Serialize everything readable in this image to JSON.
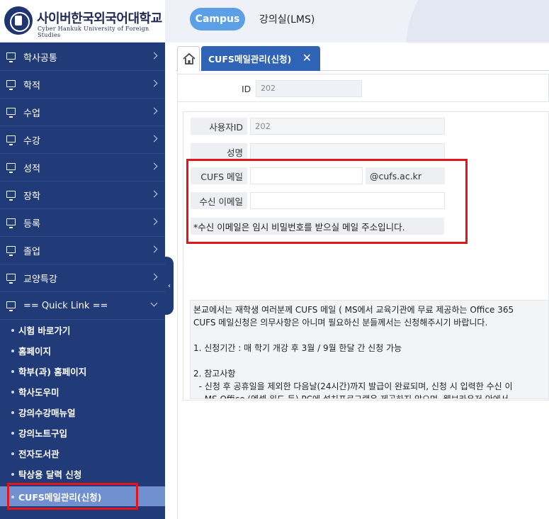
{
  "logo": {
    "name_kr": "사이버한국외국어대학교",
    "name_en": "Cyber Hankuk University of Foreign Studies"
  },
  "header": {
    "campus_label": "Campus",
    "lms_label": "강의실(LMS)"
  },
  "sidebar": {
    "items": [
      {
        "label": "학사공통"
      },
      {
        "label": "학적"
      },
      {
        "label": "수업"
      },
      {
        "label": "수강"
      },
      {
        "label": "성적"
      },
      {
        "label": "장학"
      },
      {
        "label": "등록"
      },
      {
        "label": "졸업"
      },
      {
        "label": "교양특강"
      },
      {
        "label": "== Quick Link =="
      }
    ],
    "quick_links": [
      {
        "label": "시험 바로가기"
      },
      {
        "label": "홈페이지"
      },
      {
        "label": "학부(과) 홈페이지"
      },
      {
        "label": "학사도우미"
      },
      {
        "label": "강의수강매뉴얼"
      },
      {
        "label": "강의노트구입"
      },
      {
        "label": "전자도서관"
      },
      {
        "label": "탁상용 달력 신청"
      },
      {
        "label": "CUFS메일관리(신청)"
      }
    ]
  },
  "tabs": {
    "active_label": "CUFS메일관리(신청)",
    "close_glyph": "✕"
  },
  "id_panel": {
    "label": "ID",
    "value": "202"
  },
  "form": {
    "user_id_label": "사용자ID",
    "user_id_value": "202",
    "name_label": "성명",
    "name_value": "",
    "cufs_mail_label": "CUFS 메일",
    "cufs_mail_value": "",
    "cufs_mail_suffix": "@cufs.ac.kr",
    "recv_mail_label": "수신 이메일",
    "recv_mail_value": "",
    "note": "*수신 이메일은 임시 비밀번호를 받으실 메일 주소입니다."
  },
  "info": {
    "lines": [
      "본교에서는 재학생 여러분께 CUFS 메일 ( MS에서 교육기관에 무료 제공하는 Office 365",
      "CUFS 메일신청은 의무사항은 아니며 필요하신 분들께서는 신청해주시기 바랍니다.",
      "",
      "1. 신청기간 : 매 학기 개강 후 3월 / 9월 한달 간 신청 가능",
      "",
      "2. 참고사항",
      "  - 신청 후 공휴일을 제외한 다음날(24시간)까지 발급이 완료되며, 신청 시 입력한 수신 이",
      "  - MS Office (엑셀,워드 등) PC에 설치프로그램은 제공하지 않으며, 웹브라우저 안에서"
    ]
  }
}
